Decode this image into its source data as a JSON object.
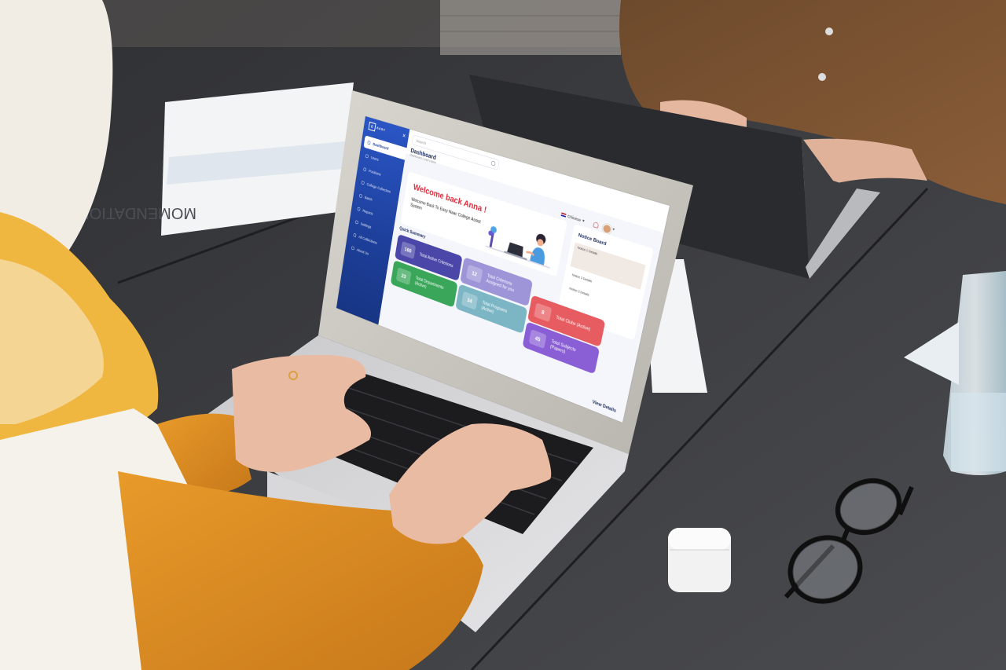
{
  "app": {
    "brand": "EASY",
    "page_title": "Dashboard",
    "breadcrumb": "Dashboard / User Home",
    "search_placeholder": "Search",
    "language": "Chi̇nese",
    "accent": "#2a55c4",
    "sidebar": {
      "items": [
        {
          "label": "Dashboard",
          "icon": "grid-icon"
        },
        {
          "label": "Users",
          "icon": "user-icon"
        },
        {
          "label": "Positions",
          "icon": "briefcase-icon"
        },
        {
          "label": "College Collection",
          "icon": "folder-icon"
        },
        {
          "label": "Batch",
          "icon": "layers-icon"
        },
        {
          "label": "Reports",
          "icon": "chart-icon"
        },
        {
          "label": "Settings",
          "icon": "gear-icon"
        },
        {
          "label": "All Collections",
          "icon": "list-icon"
        },
        {
          "label": "About Us",
          "icon": "info-icon"
        }
      ]
    },
    "welcome": {
      "title": "Welcome back Anna !",
      "subtitle": "Welcome Back To Easy Naac College Assist System"
    },
    "notice_board": {
      "title": "Notice Board",
      "items": [
        "Notice 1 Details",
        "Notice 2 Details",
        "Notice 3 Details"
      ]
    },
    "quick_summary": {
      "title": "Quick Summary",
      "view_details": "View Details",
      "cards": [
        {
          "value": "160",
          "label": "Total Active Criterions",
          "color": "#4a47a8"
        },
        {
          "value": "12",
          "label": "Total Criterions Assigned for you",
          "color": "#9d95d8"
        },
        {
          "value": "23",
          "label": "Total Departments (Active)",
          "color": "#3aa65a"
        },
        {
          "value": "34",
          "label": "Total Programs (Active)",
          "color": "#7cb6c4"
        },
        {
          "value": "8",
          "label": "Total Clubs (Active)",
          "color": "#e75c61"
        },
        {
          "value": "45",
          "label": "Total Subjects (Papers)",
          "color": "#8a5fd6"
        }
      ]
    }
  },
  "paper_doc": {
    "heading": "MOMENDATIONS:"
  }
}
